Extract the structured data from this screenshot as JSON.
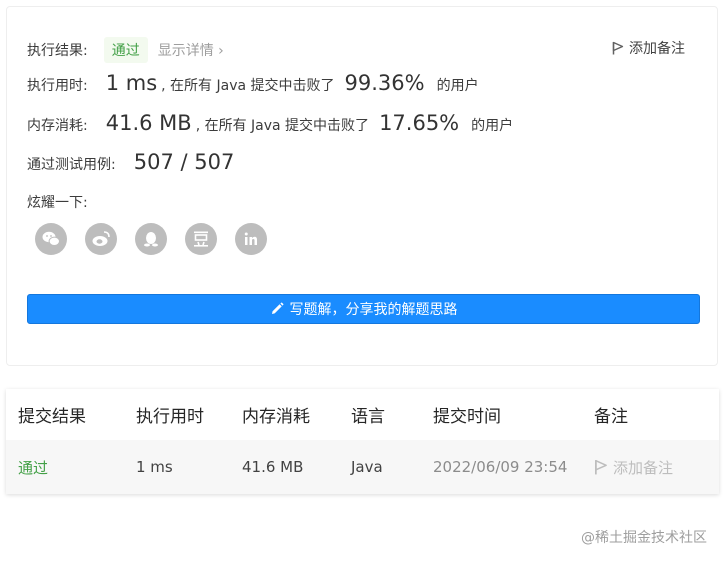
{
  "result": {
    "status_label": "执行结果:",
    "status_value": "通过",
    "detail_link": "显示详情 ›",
    "add_note": "添加备注",
    "runtime_label": "执行用时:",
    "runtime_value": "1 ms",
    "runtime_text": ", 在所有 Java 提交中击败了",
    "runtime_pct": "99.36%",
    "users_text": "的用户",
    "memory_label": "内存消耗:",
    "memory_value": "41.6 MB",
    "memory_text": ", 在所有 Java 提交中击败了",
    "memory_pct": "17.65%",
    "testcase_label": "通过测试用例:",
    "testcase_value": "507 / 507",
    "share_label": "炫耀一下:",
    "share_icons": [
      "wechat-icon",
      "weibo-icon",
      "qq-icon",
      "douban-icon",
      "linkedin-icon"
    ],
    "write_solution": "写题解，分享我的解题思路"
  },
  "table": {
    "headers": [
      "提交结果",
      "执行用时",
      "内存消耗",
      "语言",
      "提交时间",
      "备注"
    ],
    "row": {
      "result": "通过",
      "runtime": "1 ms",
      "memory": "41.6 MB",
      "language": "Java",
      "time": "2022/06/09 23:54",
      "note": "添加备注"
    }
  },
  "watermark": "@稀土掘金技术社区",
  "colors": {
    "accept": "#43a047",
    "primary_button": "#1a8cff",
    "share_icon_bg": "#bdbdbd"
  }
}
